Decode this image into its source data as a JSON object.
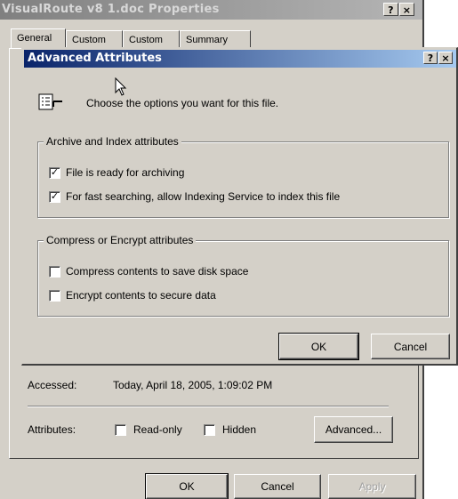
{
  "properties_window": {
    "title": "VisualRoute v8 1.doc Properties",
    "help_button": "?",
    "close_button": "×",
    "tabs": [
      "General",
      "Custom",
      "Custom",
      "Summary"
    ],
    "accessed_label": "Accessed:",
    "accessed_value": "Today, April 18, 2005, 1:09:02 PM",
    "attributes_label": "Attributes:",
    "readonly_label": "Read-only",
    "readonly_checked": false,
    "hidden_label": "Hidden",
    "hidden_checked": false,
    "advanced_button": "Advanced...",
    "ok_button": "OK",
    "cancel_button": "Cancel",
    "apply_button": "Apply"
  },
  "advanced_dialog": {
    "title": "Advanced Attributes",
    "help_button": "?",
    "close_button": "×",
    "intro_text": "Choose the options you want for this file.",
    "archive_group": {
      "legend": "Archive and Index attributes",
      "options": [
        {
          "label": "File is ready for archiving",
          "checked": true
        },
        {
          "label": "For fast searching, allow Indexing Service to index this file",
          "checked": true
        }
      ]
    },
    "compress_group": {
      "legend": "Compress or Encrypt attributes",
      "options": [
        {
          "label": "Compress contents to save disk space",
          "checked": false
        },
        {
          "label": "Encrypt contents to secure data",
          "checked": false
        }
      ]
    },
    "ok_button": "OK",
    "cancel_button": "Cancel"
  },
  "colors": {
    "dialog_face": "#d4d0c8",
    "active_title_start": "#0a246a",
    "active_title_end": "#a6caf0",
    "inactive_title": "#808080"
  },
  "icons": [
    "file-attributes-icon",
    "mouse-pointer-icon",
    "checkmark-icon"
  ]
}
